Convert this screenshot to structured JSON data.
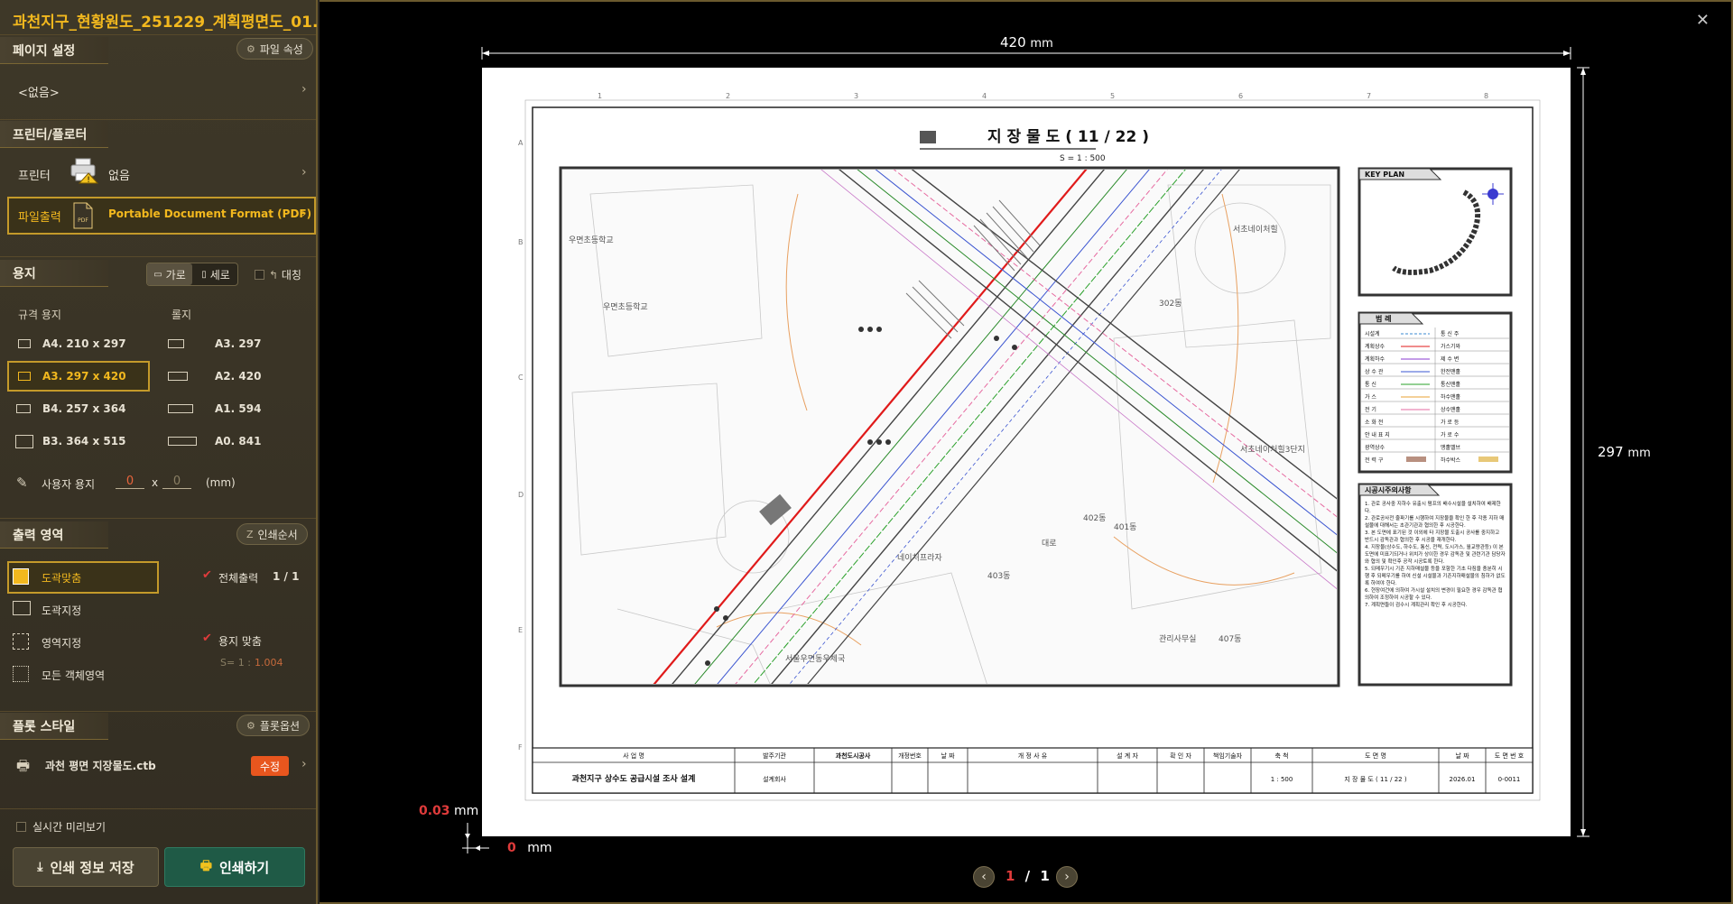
{
  "app": {
    "title": "과천지구_현황원도_251229_계획평면도_01..."
  },
  "page_setup": {
    "heading": "페이지 설정",
    "file_props_button": "파일 속성",
    "value": "<없음>"
  },
  "printer": {
    "heading": "프린터/플로터",
    "printer_label": "프린터",
    "printer_value": "없음",
    "file_output_label": "파일출력",
    "file_output_value": "Portable Document Format (PDF)"
  },
  "paper": {
    "heading": "용지",
    "landscape": "가로",
    "portrait": "세로",
    "mirror": "대칭",
    "standard_heading": "규격 용지",
    "roll_heading": "롤지",
    "standard_sizes": [
      "A4. 210 x 297",
      "A3. 297 x 420",
      "B4. 257 x 364",
      "B3. 364 x 515"
    ],
    "roll_sizes": [
      "A3. 297",
      "A2. 420",
      "A1. 594",
      "A0. 841"
    ],
    "selected": "A3. 297 x 420",
    "custom_label": "사용자 용지",
    "custom_w": "0",
    "custom_times": "x",
    "custom_h": "0",
    "custom_unit": "(mm)"
  },
  "output_area": {
    "heading": "출력 영역",
    "print_order_button": "인쇄순서",
    "options": [
      "도곽맞춤",
      "도곽지정",
      "영역지정",
      "모든 객체영역"
    ],
    "selected": "도곽맞춤",
    "full_output": "전체출력",
    "full_output_value": "1 / 1",
    "fit_paper": "용지 맞춤",
    "scale_prefix": "S= 1 :",
    "scale_value": "1.004"
  },
  "plot_style": {
    "heading": "플롯 스타일",
    "plot_options_button": "플롯옵션",
    "file": "과천 평면 지장물도.ctb",
    "edit_button": "수정"
  },
  "footer": {
    "live_preview": "실시간 미리보기",
    "save_button": "인쇄 정보 저장",
    "print_button": "인쇄하기"
  },
  "preview": {
    "width_value": "420",
    "width_unit": "mm",
    "height_value": "297",
    "height_unit": "mm",
    "offset_y_value": "0.03",
    "offset_y_unit": "mm",
    "offset_x_value": "0",
    "offset_x_unit": "mm",
    "page_current": "1",
    "page_sep": "/",
    "page_total": "1"
  },
  "drawing": {
    "title": "지 장 물 도 ( 11 / 22 )",
    "scale": "S = 1 : 500",
    "keyplan_title": "KEY PLAN",
    "legend_title": "범 례",
    "legend_left": [
      "시설계",
      "계획상수",
      "계획하수",
      "상 수 관",
      "통 신",
      "가 스",
      "전 기",
      "소 화 전",
      "안 내 표 지",
      "광역상수",
      "전 력 구"
    ],
    "legend_right": [
      "통 신 주",
      "가스기와",
      "제 수 변",
      "한전맨홀",
      "통신맨홀",
      "하수맨홀",
      "상수맨홀",
      "가 로 등",
      "가 로 수",
      "맹홀밸브",
      "하수박스"
    ],
    "notes_title": "시공시주의사항",
    "notes": [
      "1. 관로 공사중 지하수 유출시 펌프의 배수시설을 설치하여 배제한다.",
      "2. 관로공사전 줄파기를 시행하여 지장물을 확인 한 후 각종 지하 매설물에 대해서는 초관기관과 협의한 후 시공한다.",
      "3. 본 도면에 표기된 것 이외에 타 지장물 도출시 공사를 중지하고 반드시 감독관과 협의한 후 시공을 재개한다.",
      "4. 지장물(상수도, 하수도, 통신, 전력, 도시가스, 월교량관등) 이 본 도면에 미표기되거나 위치가 상이한 경우 감독관 및 관련기관 담당자와 협의 및 확인후 공작 시공토록 한다.",
      "5. 되메우기시 기존 지하매설물 등을 포함한 기초 다짐을 충분히 시행 후 되메우기를 하여 신설 시설물과 기존지하매설물의 침하가 없도록 하여야 한다.",
      "6. 현장여건에 의하여 가시설 설치의 변경이 필요한 경우 감독관 협의하여 조정하여 시공할 수 있다.",
      "7. 계획면들이 검수시 계획관리 확인 후 시공한다."
    ],
    "map_labels": [
      "우면초등학교",
      "우면초등학교",
      "서초네이처힐",
      "서초네이처힐3단지",
      "302동",
      "402동",
      "401동",
      "403동",
      "네이처프라자",
      "관리사무실",
      "407동",
      "서울우면동우체국",
      "대로"
    ],
    "grid_top": [
      "1",
      "2",
      "3",
      "4",
      "5",
      "6",
      "7",
      "8"
    ],
    "grid_side": [
      "A",
      "B",
      "C",
      "D",
      "E",
      "F"
    ],
    "titleblock": {
      "h1": "사 업 명",
      "v1": "과천지구 상수도 공급시설 조사 설계",
      "h2": "발주기관",
      "v2": "설계회사",
      "logo": "과천도시공사",
      "h3": "개정번호",
      "h4": "날 짜",
      "h5": "개 정 사 유",
      "h6": "설 계 자",
      "h7": "확 인 자",
      "h8": "책임기술자",
      "h9": "축 척",
      "v9": "1 : 500",
      "h10": "도 면 명",
      "v10": "지 장 물 도 ( 11 / 22 )",
      "h11": "날 짜",
      "v11": "2026.01",
      "h12": "도 면 번 호",
      "v12": "0-0011"
    }
  },
  "colors": {
    "accent": "#f2b81e",
    "selection_border": "#c49a2a",
    "print_button": "#1f5a46",
    "edit_button": "#e8561e",
    "red_value": "#e03b3b"
  }
}
